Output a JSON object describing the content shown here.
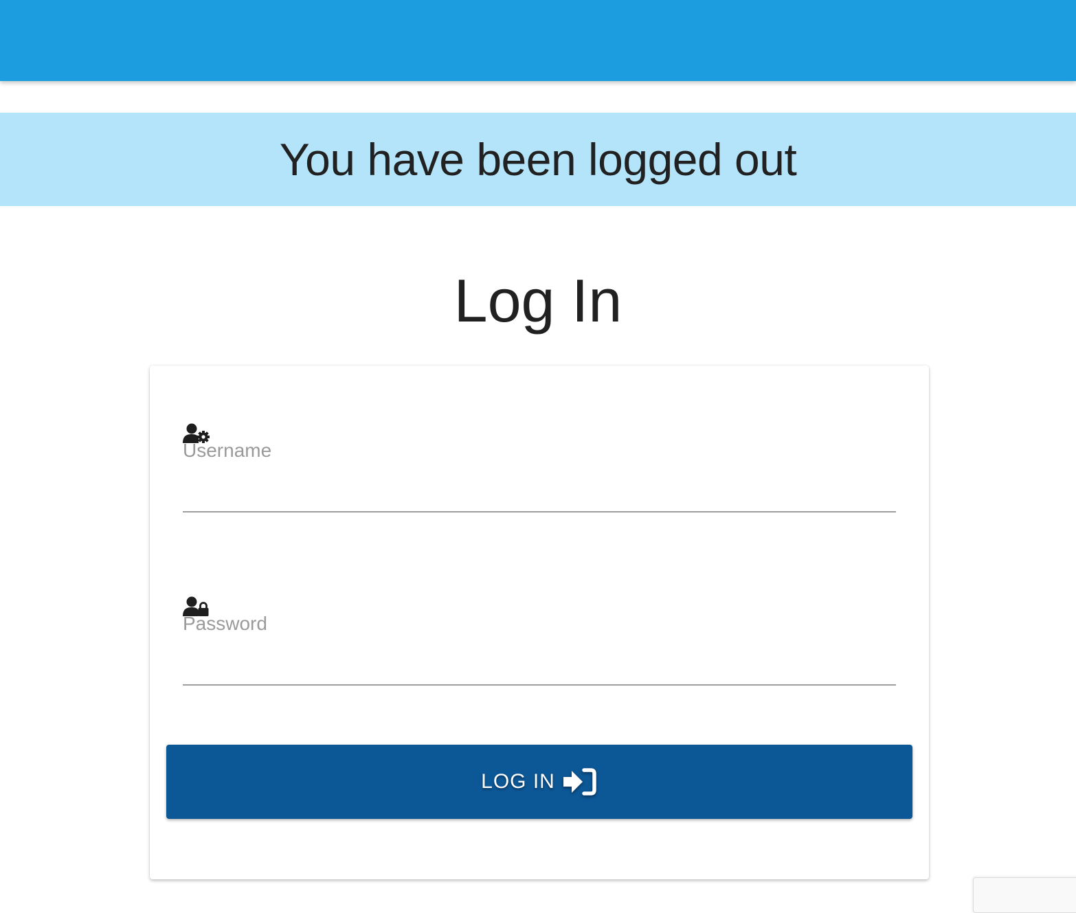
{
  "alert": {
    "message": "You have been logged out"
  },
  "page": {
    "title": "Log In"
  },
  "form": {
    "username": {
      "label": "Username",
      "value": "",
      "icon": "user-cog-icon"
    },
    "password": {
      "label": "Password",
      "value": "",
      "icon": "user-lock-icon"
    },
    "submit": {
      "label": "LOG IN",
      "icon": "sign-in-icon"
    }
  },
  "colors": {
    "header": "#1c9de0",
    "alert_bg": "#b4e4f9",
    "button": "#0c5796"
  }
}
